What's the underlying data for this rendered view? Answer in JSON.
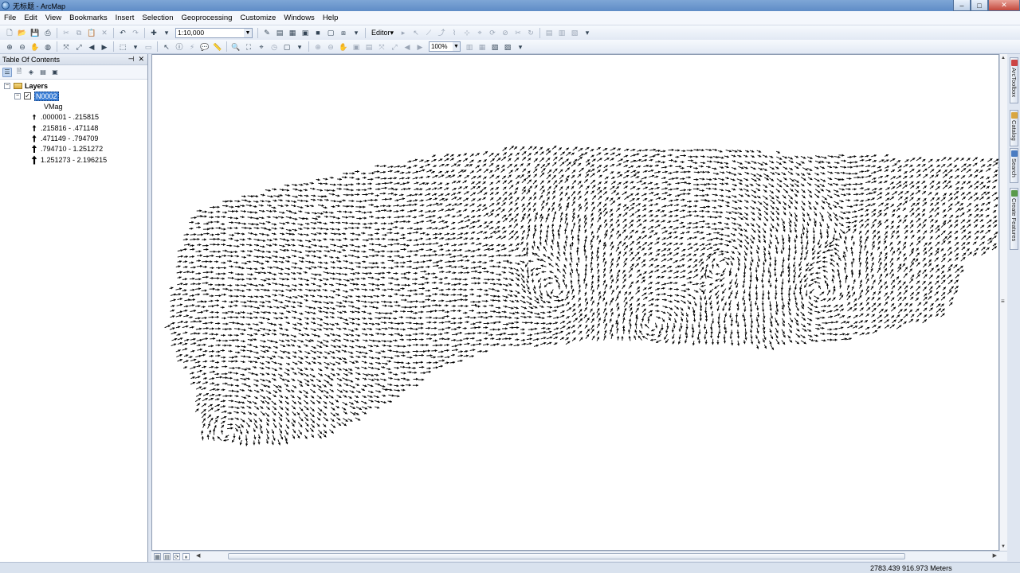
{
  "window": {
    "title": "无标题 - ArcMap",
    "minimize": "–",
    "maximize": "□",
    "close": "✕"
  },
  "menu": [
    "File",
    "Edit",
    "View",
    "Bookmarks",
    "Insert",
    "Selection",
    "Geoprocessing",
    "Customize",
    "Windows",
    "Help"
  ],
  "toolbar": {
    "scale": "1:10,000",
    "editor_label": "Editor",
    "zoom_percent": "100%"
  },
  "toc": {
    "title": "Table Of Contents",
    "root_label": "Layers",
    "layer_name": "N0002",
    "field_name": "VMag",
    "classes": [
      ".000001 - .215815",
      ".215816 - .471148",
      ".471149 - .794709",
      ".794710 - 1.251272",
      "1.251273 - 2.196215"
    ]
  },
  "side_tabs": [
    "ArcToolbox",
    "Catalog",
    "Search",
    "Create Features"
  ],
  "status": {
    "coordinates": "2783.439  916.973 Meters"
  },
  "colors": {
    "title_bar": "#6b95cc",
    "selection": "#3c7fd6",
    "vector": "#000000"
  }
}
